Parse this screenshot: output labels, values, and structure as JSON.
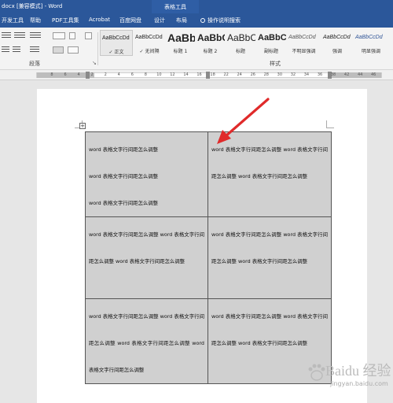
{
  "window": {
    "title": "docx [兼容模式] - Word",
    "context_tools": "表格工具"
  },
  "tabs": [
    "开发工具",
    "帮助",
    "PDF工具集",
    "Acrobat",
    "百度网盘",
    "设计",
    "布局",
    "操作说明搜索"
  ],
  "ribbon": {
    "paragraph_group_label": "段落",
    "styles_group_label": "样式",
    "styles": [
      {
        "sample": "AaBbCcDd",
        "name": "正文",
        "selected": true
      },
      {
        "sample": "AaBbCcDd",
        "name": "无间隔"
      },
      {
        "sample": "AaBb",
        "name": "标题 1"
      },
      {
        "sample": "AaBbC",
        "name": "标题 2"
      },
      {
        "sample": "AaBbC",
        "name": "标题"
      },
      {
        "sample": "AaBbC",
        "name": "副标题"
      },
      {
        "sample": "AaBbCcDd",
        "name": "不明显强调"
      },
      {
        "sample": "AaBbCcDd",
        "name": "强调"
      },
      {
        "sample": "AaBbCcDd",
        "name": "明显强调"
      }
    ]
  },
  "ruler": {
    "labels": [
      "8",
      "6",
      "4",
      "2",
      "2",
      "4",
      "6",
      "8",
      "10",
      "12",
      "14",
      "16",
      "18",
      "22",
      "24",
      "26",
      "28",
      "30",
      "32",
      "34",
      "36",
      "38",
      "42",
      "44",
      "46"
    ]
  },
  "table": {
    "rows": [
      [
        [
          "word 表格文字行间距怎么调整",
          "word 表格文字行间距怎么调整",
          "word 表格文字行间距怎么调整"
        ],
        [
          "word 表格文字行间距怎么调整 word 表格文字行间距怎么调整 word 表格文字行间距怎么调整"
        ]
      ],
      [
        [
          "word 表格文字行间距怎么调整 word 表格文字行间距怎么调整 word 表格文字行间距怎么调整"
        ],
        [
          "word 表格文字行间距怎么调整 word 表格文字行间距怎么调整 word 表格文字行间距怎么调整"
        ]
      ],
      [
        [
          "word 表格文字行间距怎么调整 word 表格文字行间距怎么调整 word 表格文字行间距怎么调整 word 表格文字行间距怎么调整"
        ],
        [
          "word 表格文字行间距怎么调整 word 表格文字行间距怎么调整 word 表格文字行间距怎么调整"
        ]
      ]
    ]
  },
  "watermark": {
    "text": "Baidu 经验",
    "url": "jingyan.baidu.com"
  },
  "colors": {
    "word_blue": "#2b579a",
    "cell_shading": "#d0d0d0",
    "arrow": "#e02a2a"
  }
}
